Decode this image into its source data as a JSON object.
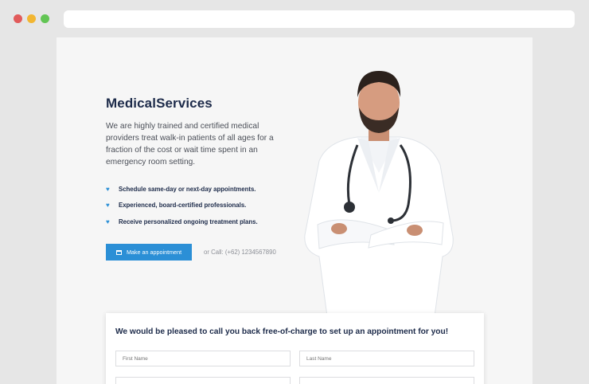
{
  "browser": {
    "dots": [
      {
        "name": "close",
        "color": "#e15b5b"
      },
      {
        "name": "minimize",
        "color": "#f2b632"
      },
      {
        "name": "maximize",
        "color": "#62c554"
      }
    ]
  },
  "hero": {
    "title_bold": "Medical",
    "title_rest": "Services",
    "description": "We are highly trained and certified medical providers treat walk-in patients of all ages for a fraction of the cost or wait time spent in an emergency room setting.",
    "features": [
      "Schedule same-day or next-day appointments.",
      "Experienced, board-certified professionals.",
      "Receive personalized ongoing treatment plans."
    ],
    "cta_label": "Make an appointment",
    "call_text": "or Call: (+62) 1234567890"
  },
  "form": {
    "title": "We would be pleased to call you back free-of-charge to set up an appointment for you!",
    "first_name_placeholder": "First Name",
    "last_name_placeholder": "Last Name"
  },
  "colors": {
    "accent": "#2b8fd6",
    "heading": "#1d2b4a"
  }
}
